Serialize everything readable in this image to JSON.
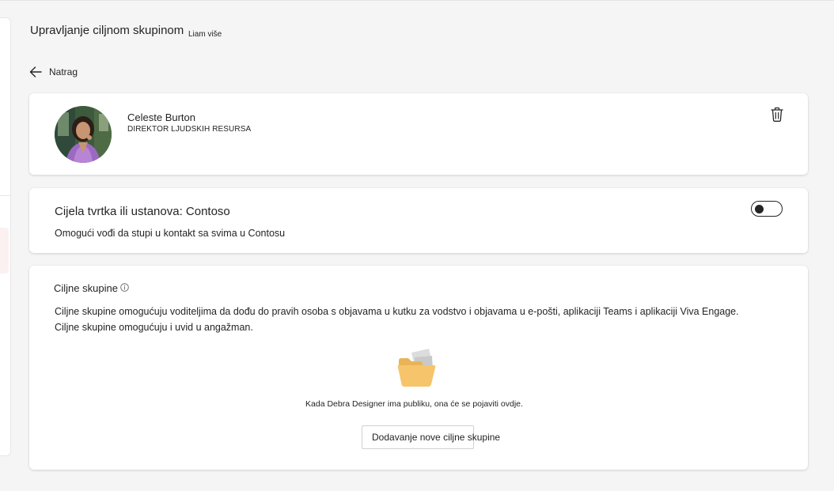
{
  "header": {
    "title": "Upravljanje ciljnom skupinom",
    "subtitle": "Liam više"
  },
  "back": {
    "label": "Natrag",
    "icon": "arrow-left-icon"
  },
  "person": {
    "name": "Celeste Burton",
    "role": "DIREKTOR LJUDSKIH RESURSA",
    "delete_icon": "trash-icon"
  },
  "organization": {
    "title": "Cijela tvrtka ili ustanova: Contoso",
    "description": "Omogući vođi da stupi u kontakt sa svima u Contosu",
    "toggle_on": false
  },
  "audiences": {
    "title": "Ciljne skupine",
    "description_line1": "Ciljne skupine omogućuju voditeljima da dođu do pravih osoba s objavama u kutku za vodstvo i objavama u e-pošti, aplikaciji Teams i aplikaciji Viva Engage.",
    "description_line2": "Ciljne skupine omogućuju i uvid u angažman.",
    "empty_state": "Kada Debra Designer ima publiku, ona će se pojaviti ovdje.",
    "add_button": "Dodavanje nove ciljne skupine",
    "empty_icon": "folder-icon"
  },
  "colors": {
    "background": "#f5f5f5",
    "card": "#ffffff",
    "text": "#242424",
    "folder": "#f6c46a"
  }
}
